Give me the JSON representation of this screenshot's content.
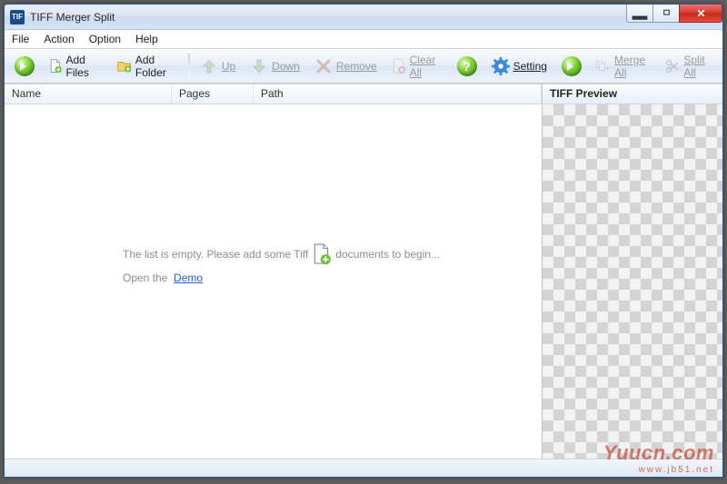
{
  "window": {
    "title": "TIFF Merger Split"
  },
  "menu": {
    "file": "File",
    "action": "Action",
    "option": "Option",
    "help": "Help"
  },
  "toolbar": {
    "addFiles": "Add Files",
    "addFolder": "Add Folder",
    "up": "Up",
    "down": "Down",
    "remove": "Remove",
    "clearAll": "Clear All",
    "setting": "Setting",
    "mergeAll": "Merge All",
    "splitAll": "Split All"
  },
  "columns": {
    "name": "Name",
    "pages": "Pages",
    "path": "Path"
  },
  "empty": {
    "line1a": "The list is empty. Please add some Tiff",
    "line1b": "documents to begin...",
    "line2a": "Open the",
    "demo": "Demo"
  },
  "preview": {
    "title": "TIFF Preview"
  },
  "watermark": {
    "brand": "Yuucn.com",
    "url": "www.jb51.net"
  }
}
